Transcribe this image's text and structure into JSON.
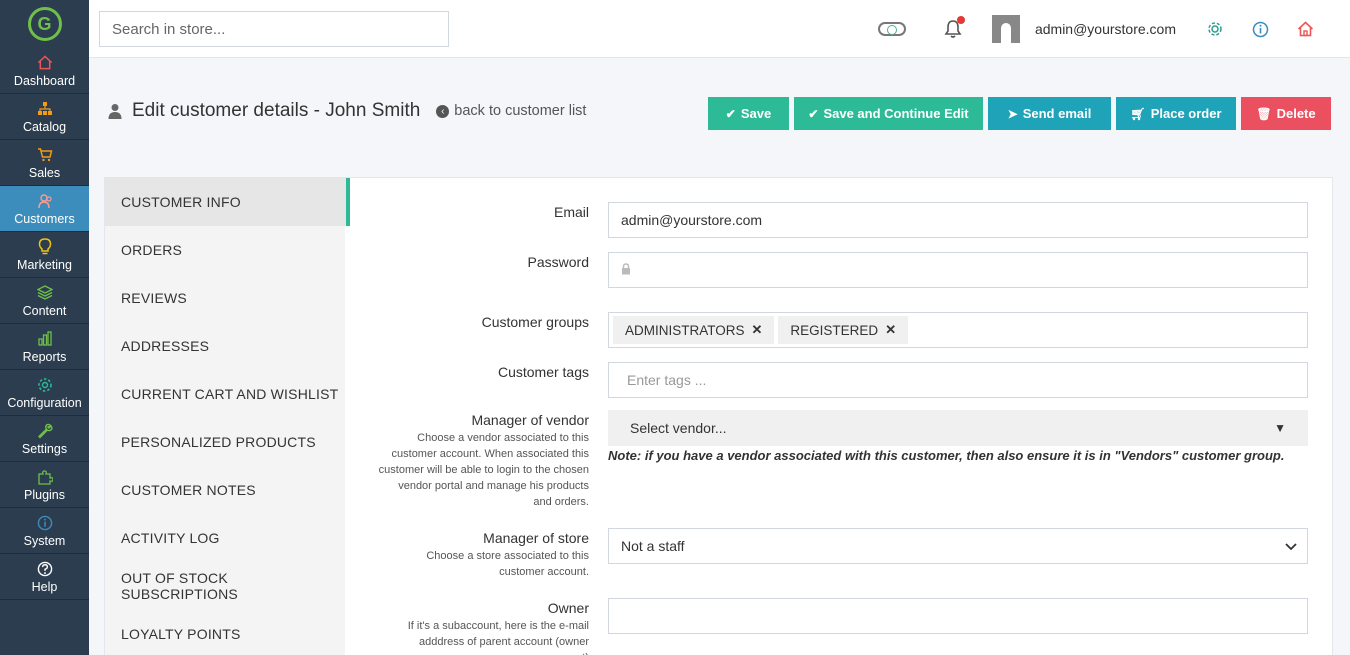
{
  "sidebar": {
    "logo": "G",
    "items": [
      {
        "label": "Dashboard",
        "icon": "home-icon",
        "color": "#e55"
      },
      {
        "label": "Catalog",
        "icon": "sitemap-icon",
        "color": "#f39c12"
      },
      {
        "label": "Sales",
        "icon": "cart-icon",
        "color": "#f39c12"
      },
      {
        "label": "Customers",
        "icon": "users-icon",
        "color": "#ff9b8e"
      },
      {
        "label": "Marketing",
        "icon": "lightbulb-icon",
        "color": "#f1c40f"
      },
      {
        "label": "Content",
        "icon": "layers-icon",
        "color": "#6fbf4a"
      },
      {
        "label": "Reports",
        "icon": "bar-chart-icon",
        "color": "#6fbf4a"
      },
      {
        "label": "Configuration",
        "icon": "gear-icon",
        "color": "#2dbb97"
      },
      {
        "label": "Settings",
        "icon": "wrench-icon",
        "color": "#6fbf4a"
      },
      {
        "label": "Plugins",
        "icon": "puzzle-icon",
        "color": "#6fbf4a"
      },
      {
        "label": "System",
        "icon": "info-icon",
        "color": "#3c8dbc"
      },
      {
        "label": "Help",
        "icon": "question-icon",
        "color": "#fff"
      }
    ]
  },
  "topbar": {
    "search_placeholder": "Search in store...",
    "user_email": "admin@yourstore.com"
  },
  "header": {
    "title": "Edit customer details - John Smith",
    "back_link": "back to customer list"
  },
  "actions": {
    "save": "Save",
    "save_continue": "Save and Continue Edit",
    "send_email": "Send email",
    "place_order": "Place order",
    "delete": "Delete"
  },
  "tabs": [
    "CUSTOMER INFO",
    "ORDERS",
    "REVIEWS",
    "ADDRESSES",
    "CURRENT CART AND WISHLIST",
    "PERSONALIZED PRODUCTS",
    "CUSTOMER NOTES",
    "ACTIVITY LOG",
    "OUT OF STOCK SUBSCRIPTIONS",
    "LOYALTY POINTS"
  ],
  "form": {
    "email_label": "Email",
    "email_value": "admin@yourstore.com",
    "password_label": "Password",
    "groups_label": "Customer groups",
    "groups": [
      "ADMINISTRATORS",
      "REGISTERED"
    ],
    "tags_label": "Customer tags",
    "tags_placeholder": "Enter tags ...",
    "vendor_label": "Manager of vendor",
    "vendor_desc": "Choose a vendor associated to this customer account. When associated this customer will be able to login to the chosen vendor portal and manage his products and orders.",
    "vendor_value": "Select vendor...",
    "vendor_note": "Note: if you have a vendor associated with this customer, then also ensure it is in \"Vendors\" customer group.",
    "store_label": "Manager of store",
    "store_desc": "Choose a store associated to this customer account.",
    "store_value": "Not a staff",
    "owner_label": "Owner",
    "owner_desc": "If it's a subaccount, here is the e-mail adddress of parent account (owner account)"
  },
  "colors": {
    "sidebar_bg": "#2b3d4f",
    "active_nav": "#3c8dbc",
    "green_btn": "#2dbb97",
    "teal_btn": "#1fa3b8",
    "red_btn": "#ea5060"
  }
}
